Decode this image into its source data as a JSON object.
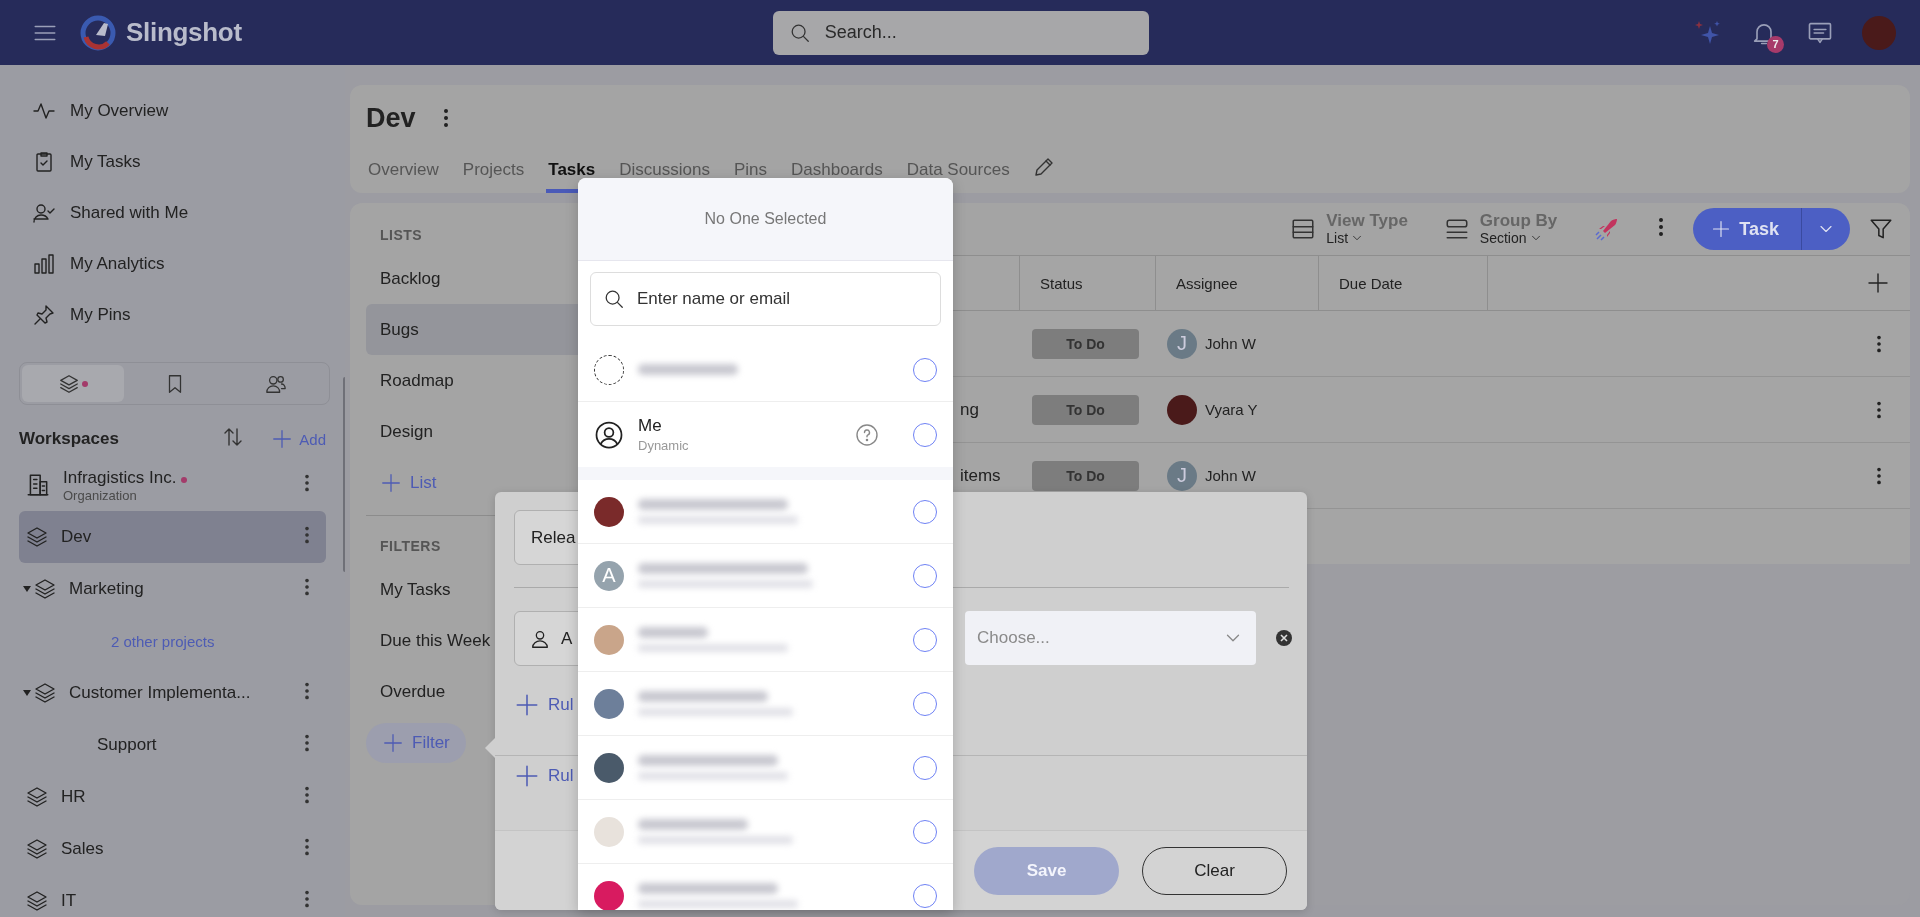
{
  "header": {
    "app_name": "Slingshot",
    "search_placeholder": "Search...",
    "notification_count": "7"
  },
  "sidebar": {
    "nav": [
      {
        "label": "My Overview"
      },
      {
        "label": "My Tasks"
      },
      {
        "label": "Shared with Me"
      },
      {
        "label": "My Analytics"
      },
      {
        "label": "My Pins"
      }
    ],
    "tabs": [
      {
        "selected": true,
        "dot": true
      },
      {
        "selected": false,
        "dot": false
      },
      {
        "selected": false,
        "dot": false
      }
    ],
    "workspaces_title": "Workspaces",
    "add_label": "Add",
    "workspaces": [
      {
        "kind": "organization",
        "name": "Infragistics Inc.",
        "subtitle": "Organization",
        "dot": true,
        "selected": false
      },
      {
        "kind": "project",
        "name": "Dev",
        "selected": true
      },
      {
        "kind": "project",
        "name": "Marketing",
        "expanded": true,
        "selected": false,
        "children": [
          {
            "kind": "link",
            "name": "2 other projects"
          }
        ]
      },
      {
        "kind": "project",
        "name": "Customer Implementa...",
        "expanded": true,
        "selected": false,
        "children": [
          {
            "kind": "sub",
            "name": "Support"
          }
        ]
      },
      {
        "kind": "project",
        "name": "HR",
        "selected": false
      },
      {
        "kind": "project",
        "name": "Sales",
        "selected": false
      },
      {
        "kind": "project",
        "name": "IT",
        "selected": false
      }
    ]
  },
  "project": {
    "title": "Dev",
    "tabs": [
      {
        "label": "Overview",
        "selected": false
      },
      {
        "label": "Projects",
        "selected": false
      },
      {
        "label": "Tasks",
        "selected": true
      },
      {
        "label": "Discussions",
        "selected": false
      },
      {
        "label": "Pins",
        "selected": false
      },
      {
        "label": "Dashboards",
        "selected": false
      },
      {
        "label": "Data Sources",
        "selected": false
      }
    ]
  },
  "lists": {
    "heading": "LISTS",
    "items": [
      {
        "label": "Backlog",
        "selected": false
      },
      {
        "label": "Bugs",
        "selected": true
      },
      {
        "label": "Roadmap",
        "selected": false
      },
      {
        "label": "Design",
        "selected": false
      }
    ],
    "add_label": "List"
  },
  "filters": {
    "heading": "FILTERS",
    "items": [
      {
        "label": "My Tasks"
      },
      {
        "label": "Due this Week"
      },
      {
        "label": "Overdue"
      }
    ],
    "add_label": "Filter"
  },
  "toolbar": {
    "view_type": {
      "label": "View Type",
      "value": "List"
    },
    "group_by": {
      "label": "Group By",
      "value": "Section"
    },
    "new_button": "Task"
  },
  "table": {
    "columns": [
      "Status",
      "Assignee",
      "Due Date"
    ],
    "rows": [
      {
        "status": "To Do",
        "assignee": {
          "name": "John W",
          "initial": "J"
        }
      },
      {
        "name": "ng",
        "status": "To Do",
        "assignee": {
          "name": "Vyara Y"
        }
      },
      {
        "name": "items",
        "status": "To Do",
        "assignee": {
          "name": "John W",
          "initial": "J"
        }
      }
    ]
  },
  "filter_panel": {
    "name_value": "Relea",
    "field_value": "A",
    "value_placeholder": "Choose...",
    "add_rule_labels": [
      "Rul",
      "Rul"
    ],
    "save": "Save",
    "save_disabled": true,
    "clear": "Clear"
  },
  "picker": {
    "title": "No One Selected",
    "search_placeholder": "Enter name or email",
    "options": [
      {
        "kind": "unassigned",
        "selected": false
      },
      {
        "kind": "me",
        "name": "Me",
        "subtitle": "Dynamic",
        "selected": false
      },
      {
        "kind": "person",
        "color": "#7a2a2a",
        "selected": false
      },
      {
        "kind": "person",
        "initial": "A",
        "selected": false
      },
      {
        "kind": "person",
        "color": "#c9a58a",
        "selected": false
      },
      {
        "kind": "person",
        "color": "#6d7f9a",
        "selected": false
      },
      {
        "kind": "person",
        "color": "#4a5a6a",
        "selected": false
      },
      {
        "kind": "person",
        "color": "#e8e2dc",
        "selected": false
      },
      {
        "kind": "person",
        "color": "#d81b60",
        "selected": false
      }
    ]
  }
}
